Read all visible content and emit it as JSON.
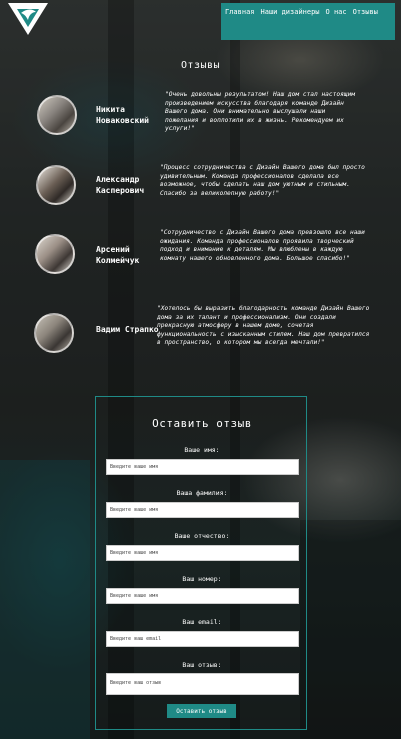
{
  "nav": {
    "items": [
      "Главная",
      "Наши дизайнеры",
      "О нас",
      "Отзывы"
    ]
  },
  "reviews_section": {
    "title": "Отзывы",
    "items": [
      {
        "name": "Никита Новаковский",
        "text": "\"Очень довольны результатом! Наш дом стал настоящим произведением искусства благодаря команде Дизайн Вашего дома. Они внимательно выслушали наши пожелания и воплотили их в жизнь. Рекомендуем их услуги!\""
      },
      {
        "name": "Александр Касперович",
        "text": "\"Процесс сотрудничества с Дизайн Вашего дома был просто удивительным. Команда профессионалов сделала все возможное, чтобы сделать наш дом уютным и стильным. Спасибо за великолепную работу!\""
      },
      {
        "name": "Арсений Колмейчук",
        "text": "\"Сотрудничество с Дизайн Вашего дома превзошло все наши ожидания. Команда профессионалов проявила творческий подход и внимание к деталям. Мы влюблены в каждую комнату нашего обновленного дома. Большое спасибо!\""
      },
      {
        "name": "Вадим Страпко",
        "text": "\"Хотелось бы выразить благодарность команде Дизайн Вашего дома за их талант и профессионализм. Они создали прекрасную атмосферу в нашем доме, сочетая функциональность с изысканным стилем. Наш дом превратился в пространство, о котором мы всегда мечтали!\""
      }
    ]
  },
  "form": {
    "title": "Оставить отзыв",
    "fields": [
      {
        "label": "Ваше имя:",
        "placeholder": "Введите ваше имя"
      },
      {
        "label": "Ваша фамилия:",
        "placeholder": "Введите ваше имя"
      },
      {
        "label": "Ваше отчество:",
        "placeholder": "Введите ваше имя"
      },
      {
        "label": "Ваш номер:",
        "placeholder": "Введите ваше имя"
      },
      {
        "label": "Ваш email:",
        "placeholder": "Введите ваш email"
      },
      {
        "label": "Ваш отзыв:",
        "placeholder": "Введите ваш отзыв"
      }
    ],
    "submit_label": "Оставить отзыв"
  },
  "colors": {
    "accent": "#1f8a86",
    "background": "#2a2c2b",
    "text": "#ffffff"
  }
}
